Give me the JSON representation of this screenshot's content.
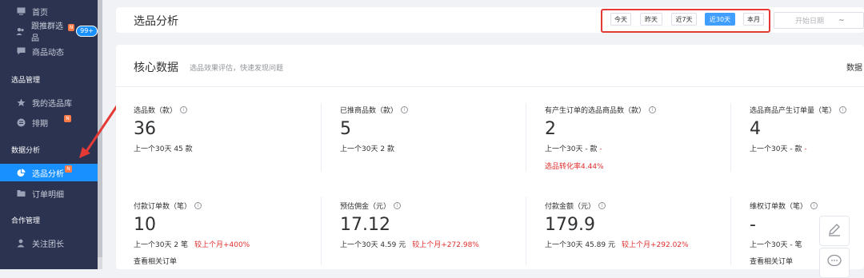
{
  "sidebar": {
    "items": [
      {
        "label": "首页",
        "icon": "monitor-icon"
      },
      {
        "label": "跟推群选品",
        "icon": "users-icon",
        "badge_new": "N",
        "badge_count": "99+"
      },
      {
        "label": "商品动态",
        "icon": "message-icon"
      },
      {
        "label": "我的选品库",
        "icon": "star-icon"
      },
      {
        "label": "排期",
        "icon": "list-icon",
        "badge_new": "N"
      },
      {
        "label": "选品分析",
        "icon": "pie-chart-icon",
        "badge_new": "N",
        "active": true
      },
      {
        "label": "订单明细",
        "icon": "folder-icon"
      },
      {
        "label": "关注团长",
        "icon": "user-icon"
      }
    ],
    "groups": [
      "选品管理",
      "数据分析",
      "合作管理"
    ]
  },
  "header": {
    "title": "选品分析",
    "range_buttons": [
      "今天",
      "昨天",
      "近7天",
      "近30天",
      "本月"
    ],
    "selected_range": "近30天",
    "start_placeholder": "开始日期",
    "separator": "~"
  },
  "core": {
    "title": "核心数据",
    "subtitle": "选品效果评估，快速发现问题",
    "right_text": "数据"
  },
  "metrics": [
    {
      "label": "选品数（款）",
      "value": "36",
      "compare_prefix": "上一个30天",
      "compare_value": "45",
      "compare_unit": "款"
    },
    {
      "label": "已推商品数（款）",
      "value": "5",
      "compare_prefix": "上一个30天",
      "compare_value": "2",
      "compare_unit": "款"
    },
    {
      "label": "有产生订单的选品商品数（款）",
      "value": "2",
      "compare_prefix": "上一个30天",
      "compare_value": "-",
      "compare_unit": "款",
      "compare_change": "-",
      "extra": "选品转化率4.44%"
    },
    {
      "label": "选品商品产生订单量（笔）",
      "value": "4",
      "compare_prefix": "上一个30天",
      "compare_value": "-",
      "compare_unit": "款",
      "compare_change": "-"
    },
    {
      "label": "付款订单数（笔）",
      "value": "10",
      "compare_prefix": "上一个30天",
      "compare_value": "2",
      "compare_unit": "笔",
      "compare_change": "较上个月+400%",
      "link": "查看相关订单"
    },
    {
      "label": "预估佣金（元）",
      "value": "17.12",
      "compare_prefix": "上一个30天",
      "compare_value": "4.59",
      "compare_unit": "元",
      "compare_change": "较上个月+272.98%"
    },
    {
      "label": "付款金额（元）",
      "value": "179.9",
      "compare_prefix": "上一个30天",
      "compare_value": "45.89",
      "compare_unit": "元",
      "compare_change": "较上个月+292.02%"
    },
    {
      "label": "维权订单数（笔）",
      "value": "-",
      "compare_prefix": "上一个30天",
      "compare_value": "-",
      "compare_unit": "笔",
      "link": "查看相关订单"
    }
  ],
  "colors": {
    "sidebar_bg": "#2b3350",
    "accent": "#1890ff",
    "highlight_border": "#e53935",
    "red": "#e02e2e"
  }
}
